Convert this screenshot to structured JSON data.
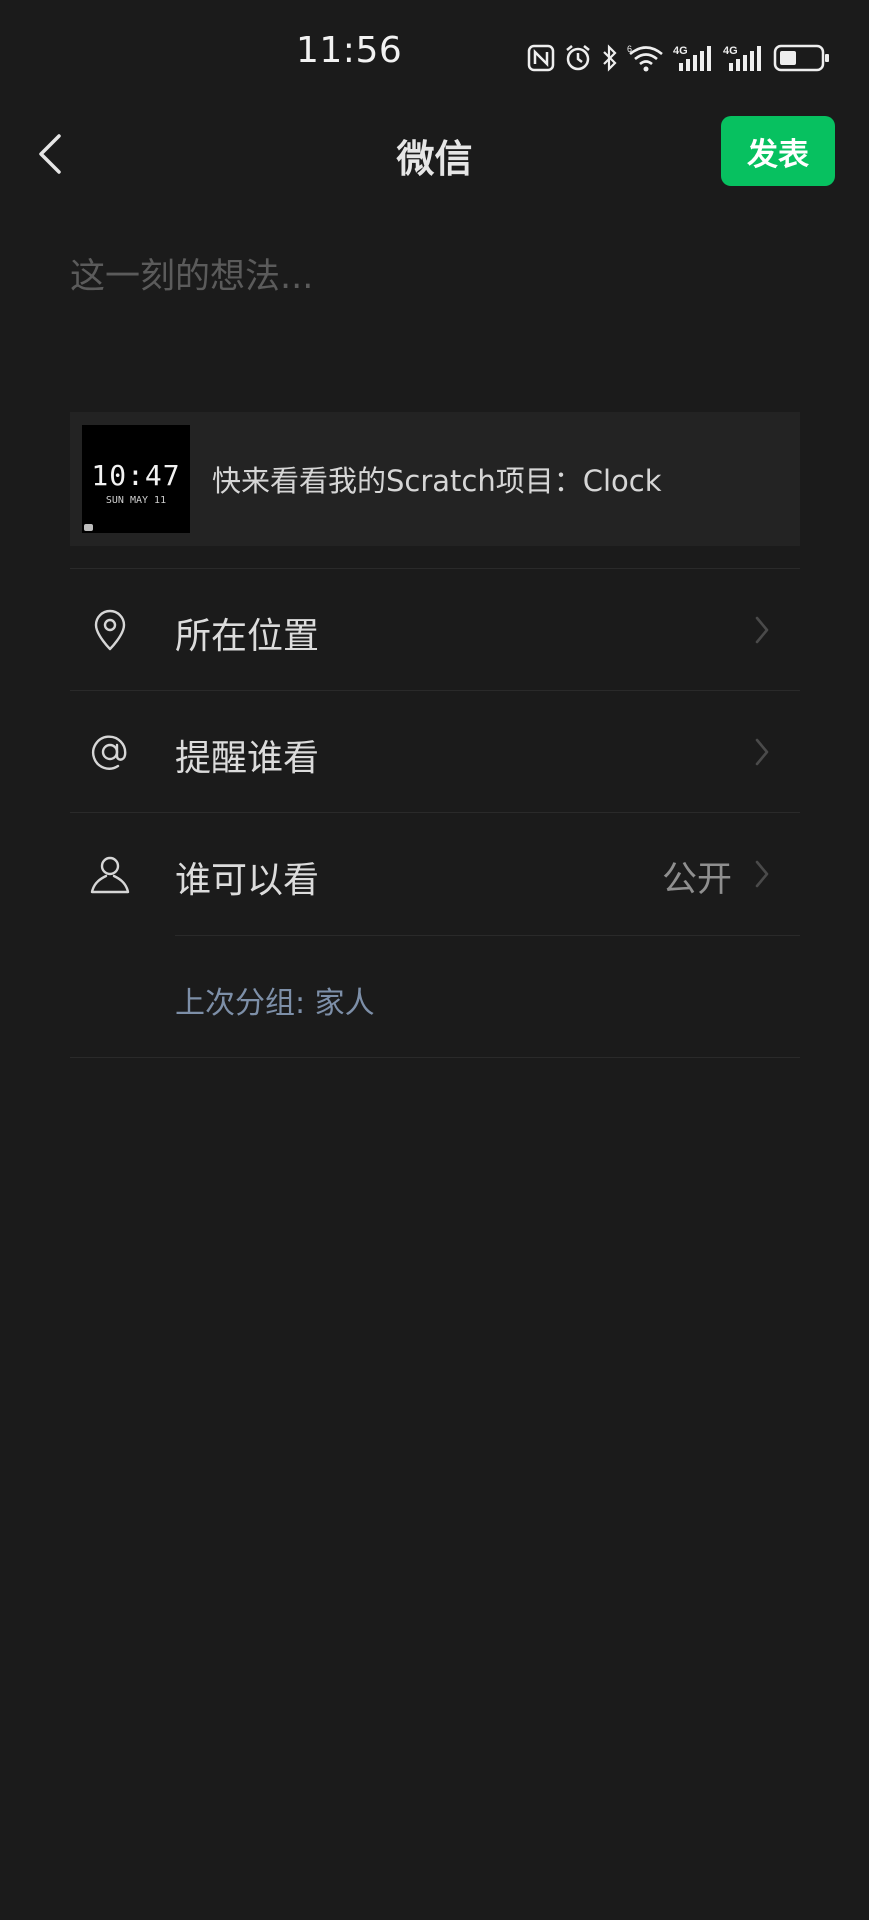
{
  "status_bar": {
    "time": "11:56",
    "icons": [
      "nfc-icon",
      "alarm-icon",
      "bluetooth-icon",
      "wifi-icon",
      "signal-4g-icon",
      "signal-4g-icon",
      "battery-icon"
    ],
    "net_labels": [
      "4G",
      "4G"
    ],
    "wifi_label": "6"
  },
  "nav": {
    "title": "微信",
    "publish_label": "发表"
  },
  "composer": {
    "placeholder": "这一刻的想法..."
  },
  "share_card": {
    "title": "快来看看我的Scratch项目：Clock",
    "thumb_time": "10:47",
    "thumb_date": "SUN MAY 11"
  },
  "rows": {
    "location": {
      "label": "所在位置",
      "icon": "location-pin-icon"
    },
    "mention": {
      "label": "提醒谁看",
      "icon": "at-icon"
    },
    "visibility": {
      "label": "谁可以看",
      "value": "公开",
      "icon": "user-icon"
    }
  },
  "last_group": "上次分组: 家人",
  "colors": {
    "background": "#1b1b1b",
    "accent": "#07c160",
    "group_text": "#7d8fa8"
  }
}
